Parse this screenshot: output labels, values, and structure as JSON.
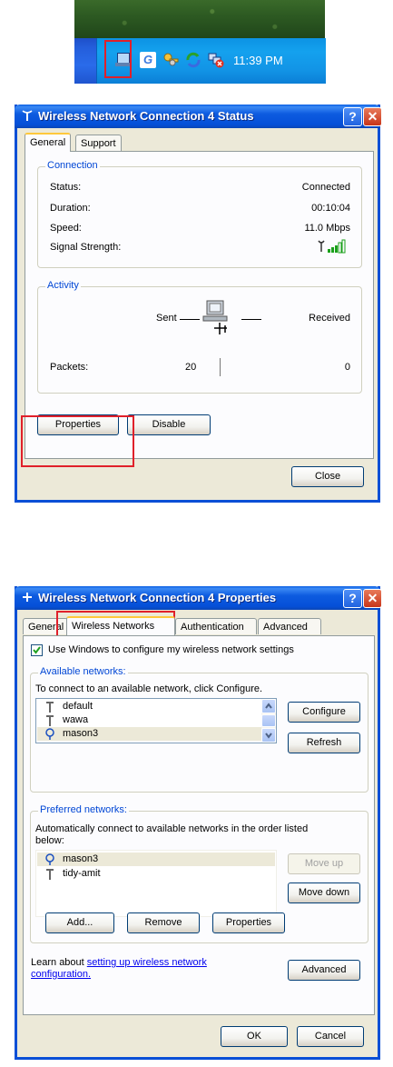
{
  "taskbar": {
    "clock": "11:39 PM",
    "icons": [
      "network-connection-icon",
      "google-g-icon",
      "keys-icon",
      "sync-icon",
      "wireless-disconnected-icon"
    ]
  },
  "status_dialog": {
    "title": "Wireless Network Connection 4 Status",
    "tabs": [
      "General",
      "Support"
    ],
    "connection": {
      "legend": "Connection",
      "status_label": "Status:",
      "status_value": "Connected",
      "duration_label": "Duration:",
      "duration_value": "00:10:04",
      "speed_label": "Speed:",
      "speed_value": "11.0 Mbps",
      "signal_label": "Signal Strength:"
    },
    "activity": {
      "legend": "Activity",
      "sent_label": "Sent",
      "received_label": "Received",
      "packets_label": "Packets:",
      "sent_packets": "20",
      "received_packets": "0"
    },
    "buttons": {
      "properties": "Properties",
      "disable": "Disable",
      "close": "Close"
    }
  },
  "properties_dialog": {
    "title": "Wireless Network Connection 4 Properties",
    "tabs": [
      "General",
      "Wireless Networks",
      "Authentication",
      "Advanced"
    ],
    "use_windows_label": "Use Windows to configure my wireless network settings",
    "use_windows_checked": true,
    "available": {
      "legend": "Available networks:",
      "instruction": "To connect to an available network, click Configure.",
      "networks": [
        "default",
        "wawa",
        "mason3"
      ],
      "configure": "Configure",
      "refresh": "Refresh"
    },
    "preferred": {
      "legend": "Preferred networks:",
      "instruction_1": "Automatically connect to available networks in the order listed",
      "instruction_2": "below:",
      "networks": [
        "mason3",
        "tidy-amit"
      ],
      "move_up": "Move up",
      "move_down": "Move down",
      "add": "Add...",
      "remove": "Remove",
      "properties": "Properties"
    },
    "learn_prefix": "Learn about ",
    "learn_link_1": "setting up wireless network",
    "learn_link_2": "configuration.",
    "advanced_button": "Advanced",
    "ok": "OK",
    "cancel": "Cancel"
  }
}
